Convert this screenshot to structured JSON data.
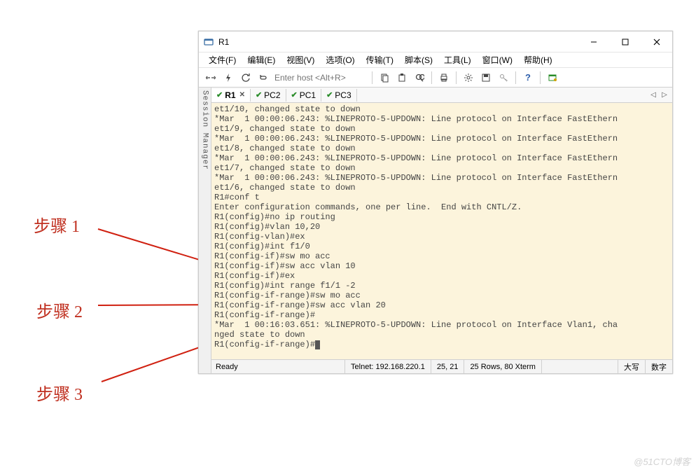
{
  "window": {
    "title": "R1"
  },
  "annotations": {
    "step1": "步骤 1",
    "step2": "步骤 2",
    "step3": "步骤 3"
  },
  "menubar": {
    "items": [
      "文件(F)",
      "编辑(E)",
      "视图(V)",
      "选项(O)",
      "传输(T)",
      "脚本(S)",
      "工具(L)",
      "窗口(W)",
      "帮助(H)"
    ]
  },
  "toolbar": {
    "host_placeholder": "Enter host <Alt+R>",
    "icons": {
      "reconnect": "reconnect-icon",
      "flash": "flash-icon",
      "sync": "sync-icon",
      "loop": "loop-icon",
      "copy": "copy-icon",
      "paste": "paste-icon",
      "find": "find-icon",
      "print": "print-icon",
      "settings": "settings-icon",
      "save": "save-icon",
      "key": "key-icon",
      "help": "help-icon",
      "extra": "extra-icon"
    }
  },
  "session_manager": {
    "label": "Session Manager"
  },
  "tabs": {
    "items": [
      {
        "label": "R1",
        "active": true,
        "closable": true
      },
      {
        "label": "PC2",
        "active": false,
        "closable": false
      },
      {
        "label": "PC1",
        "active": false,
        "closable": false
      },
      {
        "label": "PC3",
        "active": false,
        "closable": false
      }
    ],
    "nav_left": "◁",
    "nav_right": "▷"
  },
  "terminal": {
    "lines": [
      "et1/10, changed state to down",
      "*Mar  1 00:00:06.243: %LINEPROTO-5-UPDOWN: Line protocol on Interface FastEthern",
      "et1/9, changed state to down",
      "*Mar  1 00:00:06.243: %LINEPROTO-5-UPDOWN: Line protocol on Interface FastEthern",
      "et1/8, changed state to down",
      "*Mar  1 00:00:06.243: %LINEPROTO-5-UPDOWN: Line protocol on Interface FastEthern",
      "et1/7, changed state to down",
      "*Mar  1 00:00:06.243: %LINEPROTO-5-UPDOWN: Line protocol on Interface FastEthern",
      "et1/6, changed state to down",
      "R1#conf t",
      "Enter configuration commands, one per line.  End with CNTL/Z.",
      "R1(config)#no ip routing",
      "R1(config)#vlan 10,20",
      "R1(config-vlan)#ex",
      "R1(config)#int f1/0",
      "R1(config-if)#sw mo acc",
      "R1(config-if)#sw acc vlan 10",
      "R1(config-if)#ex",
      "R1(config)#int range f1/1 -2",
      "R1(config-if-range)#sw mo acc",
      "R1(config-if-range)#sw acc vlan 20",
      "R1(config-if-range)#",
      "*Mar  1 00:16:03.651: %LINEPROTO-5-UPDOWN: Line protocol on Interface Vlan1, cha",
      "nged state to down",
      "R1(config-if-range)#"
    ]
  },
  "statusbar": {
    "ready": "Ready",
    "conn": "Telnet: 192.168.220.1",
    "pos": "25,  21",
    "size": "25 Rows, 80  Xterm",
    "caps": "大写",
    "num": "数字"
  },
  "watermark": "@51CTO博客"
}
